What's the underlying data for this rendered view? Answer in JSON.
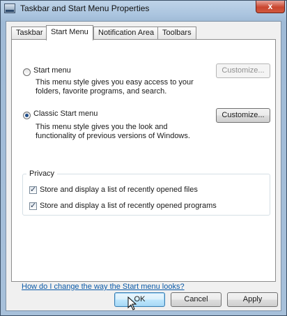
{
  "window": {
    "title": "Taskbar and Start Menu Properties",
    "close_glyph": "x"
  },
  "tabs": [
    {
      "label": "Taskbar"
    },
    {
      "label": "Start Menu"
    },
    {
      "label": "Notification Area"
    },
    {
      "label": "Toolbars"
    }
  ],
  "options": {
    "start_menu": {
      "label": "Start menu",
      "desc1": "This menu style gives you easy access to your",
      "desc2": "folders, favorite programs, and search.",
      "customize": "Customize...",
      "checked": false
    },
    "classic": {
      "label": "Classic Start menu",
      "desc1": "This menu style gives you the look and",
      "desc2": "functionality of previous versions of Windows.",
      "customize": "Customize...",
      "checked": true
    }
  },
  "privacy": {
    "title": "Privacy",
    "files": "Store and display a list of recently opened files",
    "programs": "Store and display a list of recently opened programs"
  },
  "help_link": "How do I change the way the Start menu looks?",
  "buttons": {
    "ok": "OK",
    "cancel": "Cancel",
    "apply": "Apply"
  }
}
